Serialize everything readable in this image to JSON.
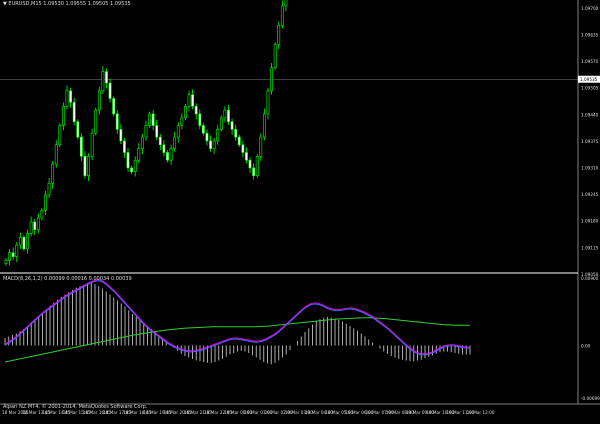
{
  "window": {
    "symbol_line": "▼ EURUSD,M15  1.09530  1.09555  1.09505  1.09535",
    "indicator_line": "MACD(8,26,1,2) 0.00099 0.00016 0.00034 0.00039",
    "bottom_note": "Alpari NZ MT4, © 2001-2014, MetaQuotes Software Corp.",
    "current_price": "1.09535"
  },
  "colors": {
    "background": "#000000",
    "candle": "#00ff00",
    "histogram": "#c0c0c0",
    "macd_line": "#ff00ff",
    "signal_line": "#3b6bff",
    "ma_line": "#32cd32",
    "separator": "#ffffff",
    "price_line": "#808080"
  },
  "chart_data": {
    "type": "line",
    "main": {
      "price_axis_labels": [
        "1.09700",
        "1.09635",
        "1.09570",
        "1.09505",
        "1.09440",
        "1.09375",
        "1.09310",
        "1.09245",
        "1.09180",
        "1.09115",
        "1.09050"
      ],
      "price_range": [
        1.0903,
        1.0972
      ],
      "closes": [
        1.0906,
        1.0908,
        1.0907,
        1.091,
        1.0912,
        1.0909,
        1.0913,
        1.0916,
        1.0914,
        1.0917,
        1.0919,
        1.0923,
        1.0926,
        1.0931,
        1.0936,
        1.0941,
        1.0946,
        1.095,
        1.0947,
        1.0942,
        1.0938,
        1.0933,
        1.0928,
        1.0933,
        1.0939,
        1.0945,
        1.095,
        1.0955,
        1.0952,
        1.0948,
        1.0944,
        1.094,
        1.0937,
        1.0934,
        1.093,
        1.0929,
        1.0932,
        1.0935,
        1.0938,
        1.0941,
        1.0944,
        1.0941,
        1.0938,
        1.0936,
        1.0934,
        1.0932,
        1.0935,
        1.0938,
        1.0941,
        1.0943,
        1.0946,
        1.0949,
        1.0946,
        1.0944,
        1.0941,
        1.0939,
        1.0937,
        1.0935,
        1.0937,
        1.094,
        1.0943,
        1.0945,
        1.0942,
        1.094,
        1.0938,
        1.0936,
        1.0934,
        1.0932,
        1.093,
        1.0928,
        1.0933,
        1.0938,
        1.0944,
        1.095,
        1.0956,
        1.0962,
        1.0967,
        1.0972,
        1.0975,
        1.0978,
        1.0982,
        1.0985,
        1.0988,
        1.0991,
        1.0989,
        1.0992,
        1.0995,
        1.0997,
        1.0994,
        1.0991,
        1.0988,
        1.0991,
        1.0995,
        1.0998,
        1.1001,
        1.1003,
        1.1006,
        1.1008,
        1.1005,
        1.1003,
        1.1001,
        1.1003,
        1.1005,
        1.1003,
        1.1001,
        1.0999,
        1.0997,
        1.0995,
        1.0993,
        1.0991,
        1.0989,
        1.0987,
        1.0989,
        1.0991,
        1.0993,
        1.0991,
        1.0989,
        1.0988,
        1.0987,
        1.0988,
        1.099,
        1.0992,
        1.0994,
        1.0991,
        1.0987
      ],
      "time_labels": [
        "18 Mar 2015",
        "18 Mar 13:45",
        "18 Mar 14:45",
        "18 Mar 15:45",
        "18 Mar 16:45",
        "18 Mar 17:45",
        "18 Mar 18:45",
        "18 Mar 19:45",
        "18 Mar 20:45",
        "18 Mar 21:45",
        "18 Mar 22:45",
        "19 Mar 00:00",
        "19 Mar 01:00",
        "19 Mar 02:00",
        "19 Mar 03:00",
        "19 Mar 04:00",
        "19 Mar 05:00",
        "19 Mar 06:00",
        "19 Mar 07:00",
        "19 Mar 08:00",
        "19 Mar 09:00",
        "19 Mar 10:00",
        "19 Mar 11:00",
        "19 Mar 12:00"
      ]
    },
    "indicator": {
      "axis_labels": [
        "0.00900",
        "0.00",
        "-0.00699"
      ],
      "range": [
        -0.007,
        0.009
      ],
      "histogram": [
        1.0,
        1.2,
        1.4,
        1.6,
        1.9,
        2.2,
        2.6,
        3.1,
        3.5,
        3.9,
        4.3,
        4.8,
        5.3,
        5.7,
        6.1,
        6.5,
        6.8,
        7.1,
        7.4,
        7.7,
        7.9,
        8.1,
        8.3,
        8.4,
        8.2,
        7.9,
        7.6,
        7.2,
        6.8,
        6.4,
        6.0,
        5.6,
        5.2,
        4.7,
        4.2,
        3.8,
        3.4,
        3.0,
        2.6,
        2.2,
        1.8,
        1.4,
        1.0,
        0.6,
        0.2,
        -0.3,
        -0.7,
        -1.1,
        -1.4,
        -1.6,
        -1.8,
        -2.0,
        -2.1,
        -2.2,
        -2.3,
        -2.3,
        -2.2,
        -2.0,
        -1.8,
        -1.5,
        -1.2,
        -1.0,
        -0.8,
        -0.7,
        -0.8,
        -1.0,
        -1.3,
        -1.6,
        -1.9,
        -2.2,
        -2.4,
        -2.5,
        -2.3,
        -2.0,
        -1.6,
        -1.2,
        -0.6,
        0.0,
        0.6,
        1.2,
        1.8,
        2.3,
        2.8,
        3.2,
        3.5,
        3.7,
        3.8,
        3.7,
        3.6,
        3.4,
        3.2,
        2.9,
        2.6,
        2.3,
        2.0,
        1.6,
        1.2,
        0.8,
        0.4,
        0.0,
        -0.4,
        -0.8,
        -1.1,
        -1.4,
        -1.6,
        -1.8,
        -1.9,
        -2.0,
        -2.1,
        -2.1,
        -2.0,
        -1.9,
        -1.7,
        -1.5,
        -1.3,
        -1.1,
        -0.9,
        -0.8,
        -0.8,
        -0.9,
        -1.0,
        -1.1,
        -1.2,
        -1.2,
        -1.2
      ],
      "macd": [
        0.2,
        0.5,
        0.9,
        1.3,
        1.8,
        2.3,
        2.8,
        3.3,
        3.8,
        4.3,
        4.7,
        5.1,
        5.5,
        5.9,
        6.3,
        6.7,
        7.0,
        7.3,
        7.6,
        7.9,
        8.2,
        8.5,
        8.7,
        8.8,
        8.6,
        8.2,
        7.7,
        7.2,
        6.6,
        6.0,
        5.4,
        4.8,
        4.2,
        3.6,
        3.0,
        2.5,
        2.0,
        1.6,
        1.2,
        0.8,
        0.4,
        0.1,
        -0.2,
        -0.4,
        -0.6,
        -0.7,
        -0.7,
        -0.6,
        -0.5,
        -0.3,
        -0.1,
        0.1,
        0.3,
        0.5,
        0.7,
        0.9,
        1.0,
        1.0,
        0.9,
        0.8,
        0.7,
        0.6,
        0.6,
        0.7,
        0.9,
        1.2,
        1.5,
        1.9,
        2.4,
        2.9,
        3.4,
        3.9,
        4.4,
        4.9,
        5.3,
        5.6,
        5.7,
        5.6,
        5.4,
        5.1,
        4.9,
        4.8,
        4.8,
        4.9,
        5.0,
        5.0,
        4.9,
        4.7,
        4.5,
        4.2,
        3.9,
        3.5,
        3.1,
        2.7,
        2.3,
        1.8,
        1.3,
        0.8,
        0.3,
        -0.2,
        -0.6,
        -0.9,
        -1.1,
        -1.1,
        -1.0,
        -0.8,
        -0.5,
        -0.2,
        0.0,
        0.1,
        0.1,
        0.0,
        -0.1,
        -0.2,
        -0.2
      ],
      "ma": [
        -2.2,
        -2.0,
        -1.8,
        -1.6,
        -1.4,
        -1.2,
        -1.0,
        -0.8,
        -0.6,
        -0.4,
        -0.2,
        0.0,
        0.2,
        0.4,
        0.6,
        0.8,
        1.0,
        1.2,
        1.4,
        1.55,
        1.7,
        1.85,
        2.0,
        2.1,
        2.2,
        2.3,
        2.35,
        2.4,
        2.45,
        2.5,
        2.5,
        2.5,
        2.5,
        2.5,
        2.5,
        2.5,
        2.55,
        2.6,
        2.7,
        2.8,
        2.9,
        3.0,
        3.1,
        3.2,
        3.3,
        3.4,
        3.5,
        3.55,
        3.6,
        3.65,
        3.7,
        3.7,
        3.65,
        3.6,
        3.5,
        3.4,
        3.3,
        3.2,
        3.1,
        3.0,
        2.9,
        2.8,
        2.75,
        2.7,
        2.7,
        2.7
      ]
    }
  }
}
